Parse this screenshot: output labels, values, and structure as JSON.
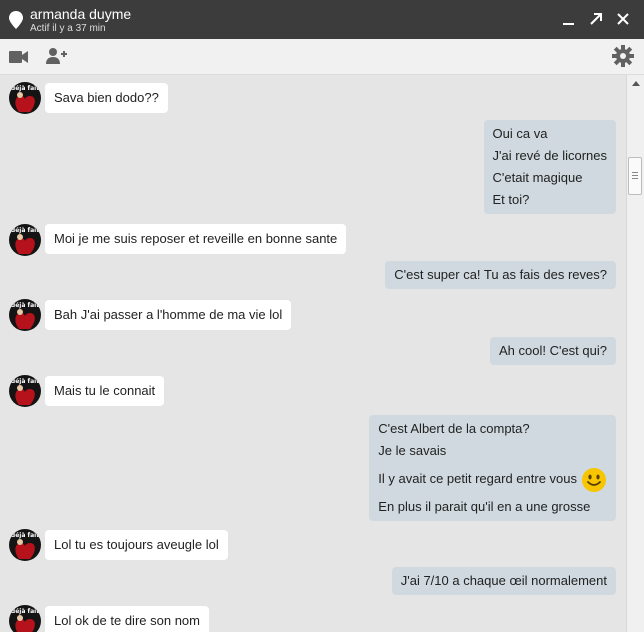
{
  "header": {
    "contact_name": "armanda duyme",
    "status": "Actif il y a 37 min"
  },
  "avatar": {
    "text": "déjà fait"
  },
  "colors": {
    "titlebar": "#3c3c3c",
    "outgoing_bubble": "#d0d9df",
    "incoming_bubble": "#ffffff",
    "chat_background": "#e5e5e5"
  },
  "icons": {
    "title": "location-pin-icon",
    "toolbar_left": [
      "video-call-icon",
      "add-person-icon"
    ],
    "toolbar_right": "settings-gear-icon",
    "window": [
      "minimize-icon",
      "pop-out-icon",
      "close-icon"
    ]
  },
  "messages": [
    {
      "dir": "in",
      "lines": [
        "Sava bien dodo??"
      ]
    },
    {
      "dir": "out",
      "lines": [
        "Oui ca va",
        "J'ai revé de licornes",
        "C'etait magique",
        "Et toi?"
      ]
    },
    {
      "dir": "in",
      "lines": [
        "Moi je me suis reposer et reveille en bonne sante"
      ]
    },
    {
      "dir": "out",
      "lines": [
        "C'est super ca! Tu as fais des reves?"
      ]
    },
    {
      "dir": "in",
      "lines": [
        "Bah J'ai passer a l'homme de ma vie lol"
      ]
    },
    {
      "dir": "out",
      "lines": [
        "Ah cool! C'est qui?"
      ]
    },
    {
      "dir": "in",
      "lines": [
        "Mais tu le connait"
      ]
    },
    {
      "dir": "out",
      "lines": [
        "C'est Albert de la compta?",
        "Je le savais",
        "Il y avait ce petit regard entre vous",
        "En plus il parait qu'il en a une grosse"
      ]
    },
    {
      "dir": "in",
      "lines": [
        "Lol tu es toujours aveugle lol"
      ]
    },
    {
      "dir": "out",
      "lines": [
        "J'ai 7/10 a chaque œil normalement"
      ]
    },
    {
      "dir": "in",
      "lines": [
        "Lol ok de te dire son nom"
      ]
    }
  ]
}
